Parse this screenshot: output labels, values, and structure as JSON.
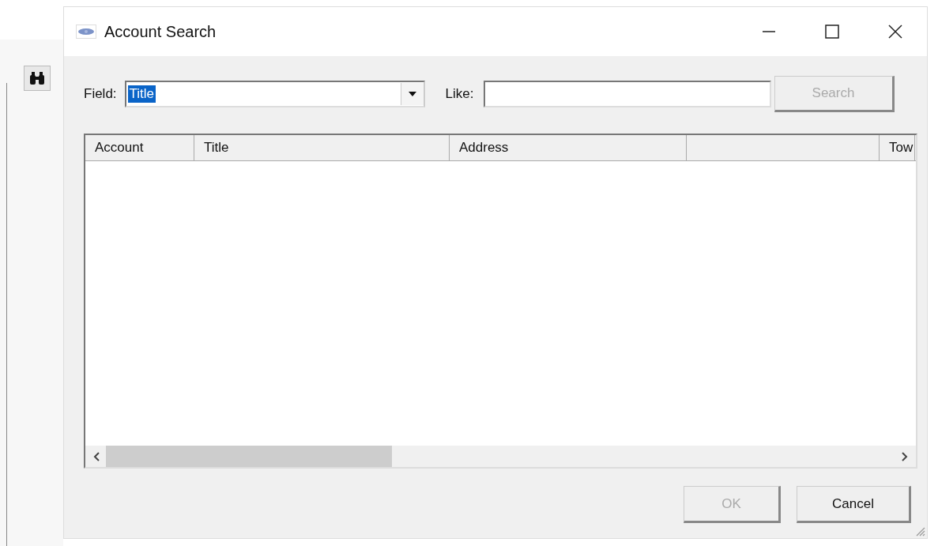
{
  "window": {
    "title": "Account Search"
  },
  "field": {
    "label": "Field:",
    "value": "Title",
    "value_selected": true
  },
  "like": {
    "label": "Like:"
  },
  "search_button": {
    "label": "Search",
    "disabled": true
  },
  "table": {
    "columns": [
      {
        "label": "Account"
      },
      {
        "label": "Title"
      },
      {
        "label": "Address"
      },
      {},
      {
        "label": "Tow"
      }
    ]
  },
  "buttons": [
    {
      "label": "OK",
      "disabled": true
    },
    {
      "label": "Cancel",
      "disabled": false
    }
  ]
}
